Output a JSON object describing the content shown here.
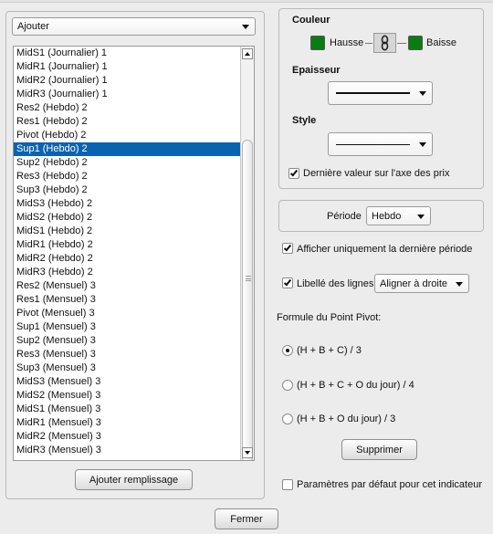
{
  "left": {
    "add_select": "Ajouter",
    "items": [
      "MidS1 (Journalier) 1",
      "MidR1 (Journalier) 1",
      "MidR2 (Journalier) 1",
      "MidR3 (Journalier) 1",
      "Res2 (Hebdo) 2",
      "Res1 (Hebdo) 2",
      "Pivot (Hebdo) 2",
      "Sup1 (Hebdo) 2",
      "Sup2 (Hebdo) 2",
      "Res3 (Hebdo) 2",
      "Sup3 (Hebdo) 2",
      "MidS3 (Hebdo) 2",
      "MidS2 (Hebdo) 2",
      "MidS1 (Hebdo) 2",
      "MidR1 (Hebdo) 2",
      "MidR2 (Hebdo) 2",
      "MidR3 (Hebdo) 2",
      "Res2 (Mensuel) 3",
      "Res1 (Mensuel) 3",
      "Pivot (Mensuel) 3",
      "Sup1 (Mensuel) 3",
      "Sup2 (Mensuel) 3",
      "Res3 (Mensuel) 3",
      "Sup3 (Mensuel) 3",
      "MidS3 (Mensuel) 3",
      "MidS2 (Mensuel) 3",
      "MidS1 (Mensuel) 3",
      "MidR1 (Mensuel) 3",
      "MidR2 (Mensuel) 3",
      "MidR3 (Mensuel) 3"
    ],
    "selected_item": "Sup1 (Hebdo) 2",
    "add_fill_button": "Ajouter remplissage"
  },
  "color": {
    "title": "Couleur",
    "up_label": "Hausse",
    "down_label": "Baisse",
    "up_color": "#0a7d12",
    "down_color": "#0a7d12"
  },
  "thickness": {
    "title": "Epaisseur"
  },
  "style": {
    "title": "Style"
  },
  "last_value_axis": {
    "label": "Dernière valeur sur l'axe des prix",
    "checked": true
  },
  "period": {
    "label": "Période",
    "value": "Hebdo"
  },
  "only_last_period": {
    "label": "Afficher uniquement la dernière période",
    "checked": true
  },
  "line_labels": {
    "label": "Libellé des lignes",
    "checked": true,
    "align_value": "Aligner à droite"
  },
  "pivot_formula": {
    "title": "Formule du Point Pivot:",
    "options": [
      "(H + B + C) / 3",
      "(H + B + C + O du jour) / 4",
      "(H + B + O du jour) / 3"
    ],
    "selected": "(H + B + C) / 3"
  },
  "delete_button": "Supprimer",
  "default_params": {
    "label": "Paramètres par défaut pour cet indicateur",
    "checked": false
  },
  "close_button": "Fermer"
}
